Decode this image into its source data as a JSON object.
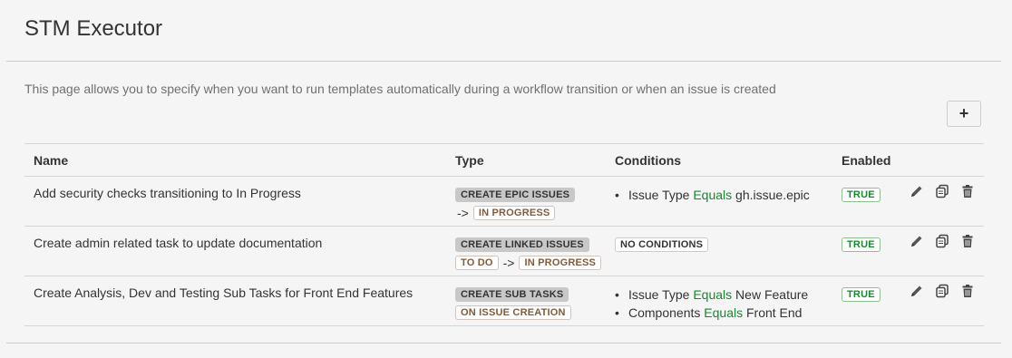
{
  "page": {
    "title": "STM Executor",
    "description": "This page allows you to specify when you want to run templates automatically during a workflow transition or when an issue is created",
    "add_button_label": "+"
  },
  "table": {
    "headers": {
      "name": "Name",
      "type": "Type",
      "conditions": "Conditions",
      "enabled": "Enabled"
    },
    "rows": [
      {
        "name": "Add security checks transitioning to In Progress",
        "type_label": "CREATE EPIC ISSUES",
        "from_status": "",
        "arrow": "->",
        "to_status": "IN PROGRESS",
        "conditions": [
          {
            "field": "Issue Type",
            "operator": "Equals",
            "value": "gh.issue.epic"
          }
        ],
        "enabled": "TRUE"
      },
      {
        "name": "Create admin related task to update documentation",
        "type_label": "CREATE LINKED ISSUES",
        "from_status": "TO DO",
        "arrow": "->",
        "to_status": "IN PROGRESS",
        "no_conditions_label": "NO CONDITIONS",
        "enabled": "TRUE"
      },
      {
        "name": "Create Analysis, Dev and Testing Sub Tasks for Front End Features",
        "type_label": "CREATE SUB TASKS",
        "trigger": "ON ISSUE CREATION",
        "conditions": [
          {
            "field": "Issue Type",
            "operator": "Equals",
            "value": "New Feature"
          },
          {
            "field": "Components",
            "operator": "Equals",
            "value": "Front End"
          }
        ],
        "enabled": "TRUE"
      }
    ]
  },
  "icons": {
    "edit": "pencil-icon",
    "copy": "copy-icon",
    "delete": "trash-icon"
  },
  "colors": {
    "operator_green": "#14892c",
    "status_brown": "#815b3a",
    "lozenge_grey": "#c8c8c8"
  }
}
